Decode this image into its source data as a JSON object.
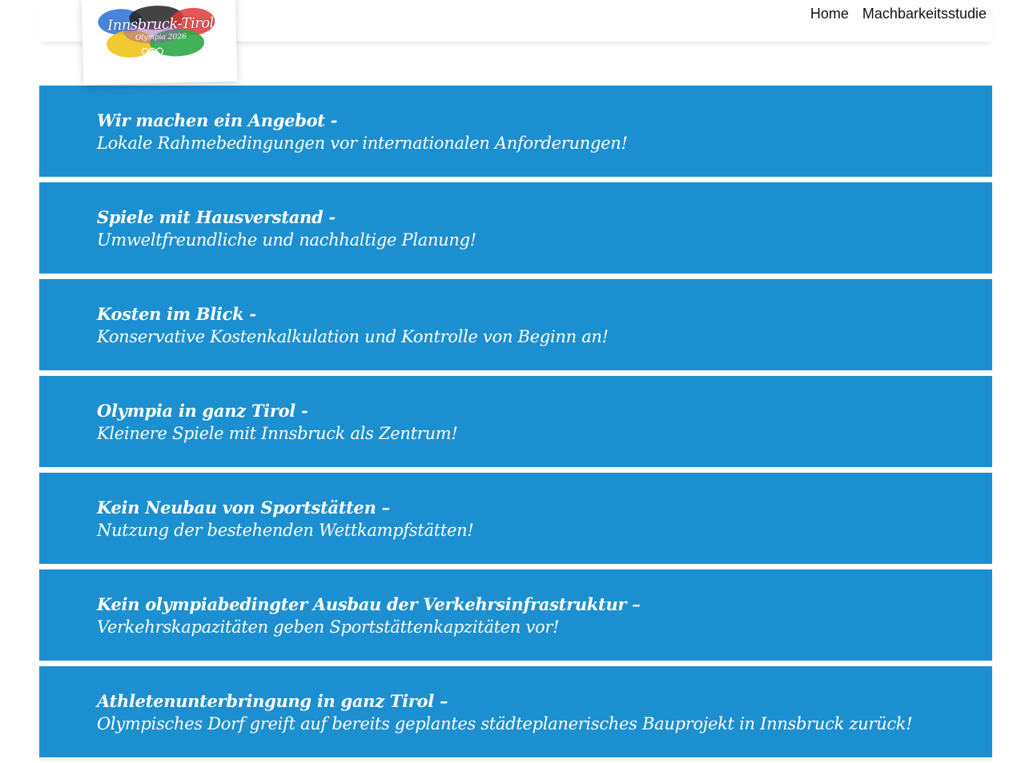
{
  "logo": {
    "title": "Innsbruck-Tirol",
    "subtitle": "Olympia 2026",
    "icon": "olympic-rings"
  },
  "nav": {
    "items": [
      {
        "label": "Home"
      },
      {
        "label": "Machbarkeitsstudie"
      }
    ]
  },
  "colors": {
    "panel": "#1c8fd0",
    "text": "#ffffff"
  },
  "panels": [
    {
      "title": "Wir machen ein Angebot -",
      "text": "Lokale Rahmebedingungen vor internationalen Anforderungen!"
    },
    {
      "title": "Spiele mit Hausverstand -",
      "text": "Umweltfreundliche und nachhaltige Planung!"
    },
    {
      "title": "Kosten im Blick -",
      "text": "Konservative Kostenkalkulation und Kontrolle von Beginn an!"
    },
    {
      "title": "Olympia in ganz Tirol -",
      "text": "Kleinere Spiele mit Innsbruck als Zentrum!"
    },
    {
      "title": "Kein Neubau von Sportstätten –",
      "text": "Nutzung der bestehenden Wettkampfstätten!"
    },
    {
      "title": "Kein olympiabedingter Ausbau der Verkehrsinfrastruktur –",
      "text": "Verkehrskapazitäten geben Sportstättenkapzitäten vor!"
    },
    {
      "title": "Athletenunterbringung in ganz Tirol –",
      "text": "Olympisches Dorf greift auf bereits geplantes städteplanerisches Bauprojekt in Innsbruck zurück!"
    }
  ]
}
